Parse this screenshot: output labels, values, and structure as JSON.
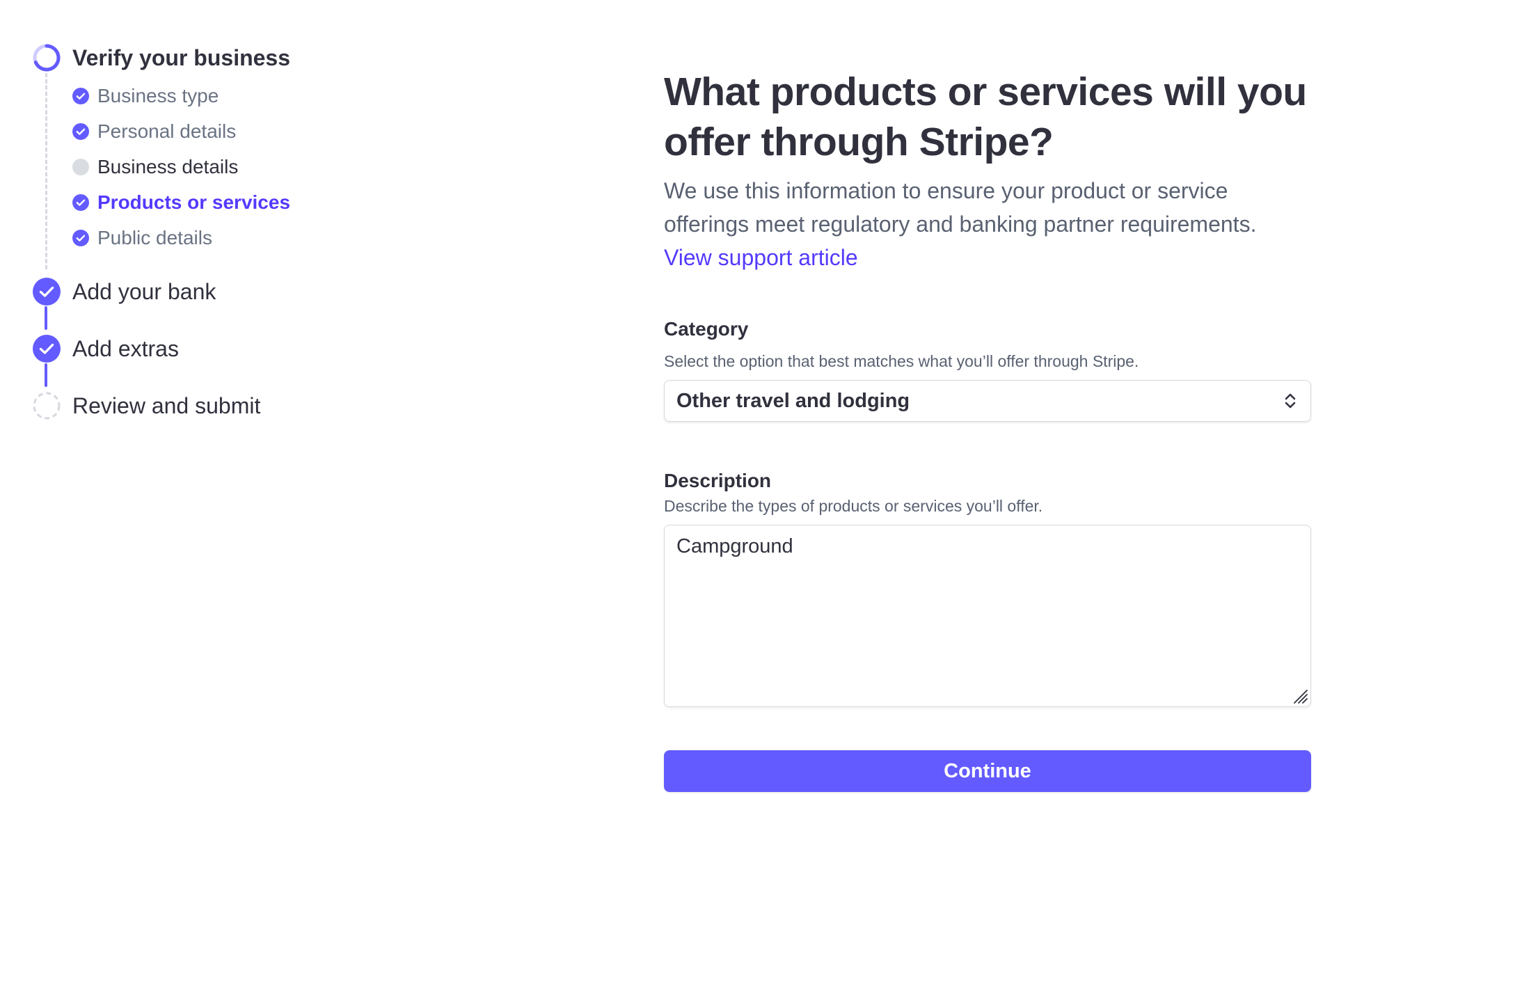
{
  "colors": {
    "accent": "#635bff",
    "accent_text": "#533afd",
    "text_primary": "#30313d",
    "text_secondary": "#596171",
    "border": "#d5d8de"
  },
  "sidebar": {
    "steps": [
      {
        "label": "Verify your business",
        "status": "in-progress",
        "icon": "progress-ring-icon",
        "substeps": [
          {
            "label": "Business type",
            "status": "complete",
            "icon": "check-circle-icon"
          },
          {
            "label": "Personal details",
            "status": "complete",
            "icon": "check-circle-icon"
          },
          {
            "label": "Business details",
            "status": "incomplete",
            "icon": "empty-circle-icon"
          },
          {
            "label": "Products or services",
            "status": "active",
            "icon": "check-circle-icon"
          },
          {
            "label": "Public details",
            "status": "complete",
            "icon": "check-circle-icon"
          }
        ]
      },
      {
        "label": "Add your bank",
        "status": "complete",
        "icon": "check-circle-icon"
      },
      {
        "label": "Add extras",
        "status": "complete",
        "icon": "check-circle-icon"
      },
      {
        "label": "Review and submit",
        "status": "pending",
        "icon": "dashed-circle-icon"
      }
    ]
  },
  "main": {
    "title": "What products or services will you offer through Stripe?",
    "description": "We use this information to ensure your product or service offerings meet regulatory and banking partner requirements.",
    "support_link": "View support article",
    "category": {
      "label": "Category",
      "help": "Select the option that best matches what you’ll offer through Stripe.",
      "value": "Other travel and lodging"
    },
    "description_field": {
      "label": "Description",
      "help": "Describe the types of products or services you’ll offer.",
      "value": "Campground"
    },
    "continue_label": "Continue"
  }
}
